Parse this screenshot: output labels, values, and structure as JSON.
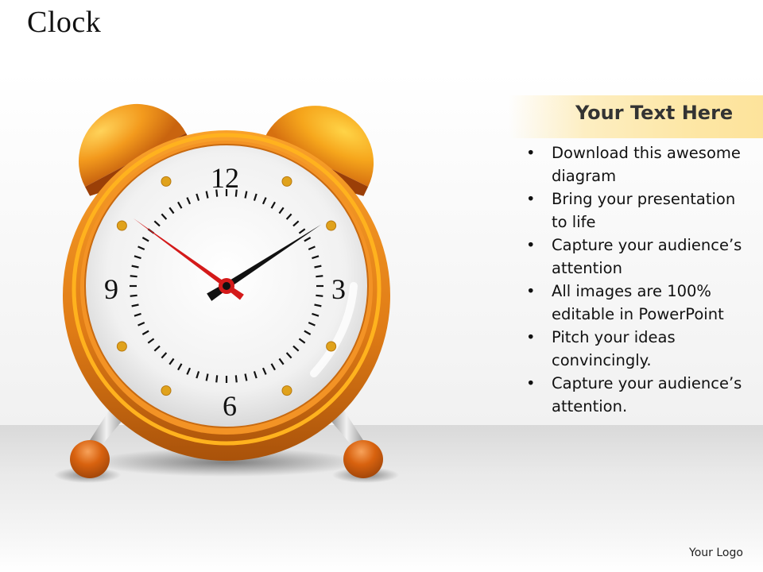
{
  "slide": {
    "title": "Clock",
    "logo": "Your Logo"
  },
  "panel": {
    "header": "Your Text Here",
    "bullets": [
      "Download this awesome diagram",
      "Bring your presentation to life",
      "Capture your audience’s attention",
      "All images are 100% editable in PowerPoint",
      "Pitch your ideas convincingly.",
      "Capture your audience’s attention."
    ],
    "bullet_glyph": "•"
  },
  "clock": {
    "numerals": {
      "twelve": "12",
      "three": "3",
      "six": "6",
      "nine": "9"
    },
    "time_shown": {
      "black_hand_hour_position": 1.9,
      "red_hand_hour_position": 10.2
    },
    "colors": {
      "body": "#f28c1e",
      "body_dark": "#b85a0c",
      "rim": "#ffb41f",
      "bell": "#f5a01d",
      "face": "#f3f3f3",
      "red_hand": "#d41a1a",
      "black_hand": "#111111",
      "marker_dots": "#e0a21c"
    }
  }
}
